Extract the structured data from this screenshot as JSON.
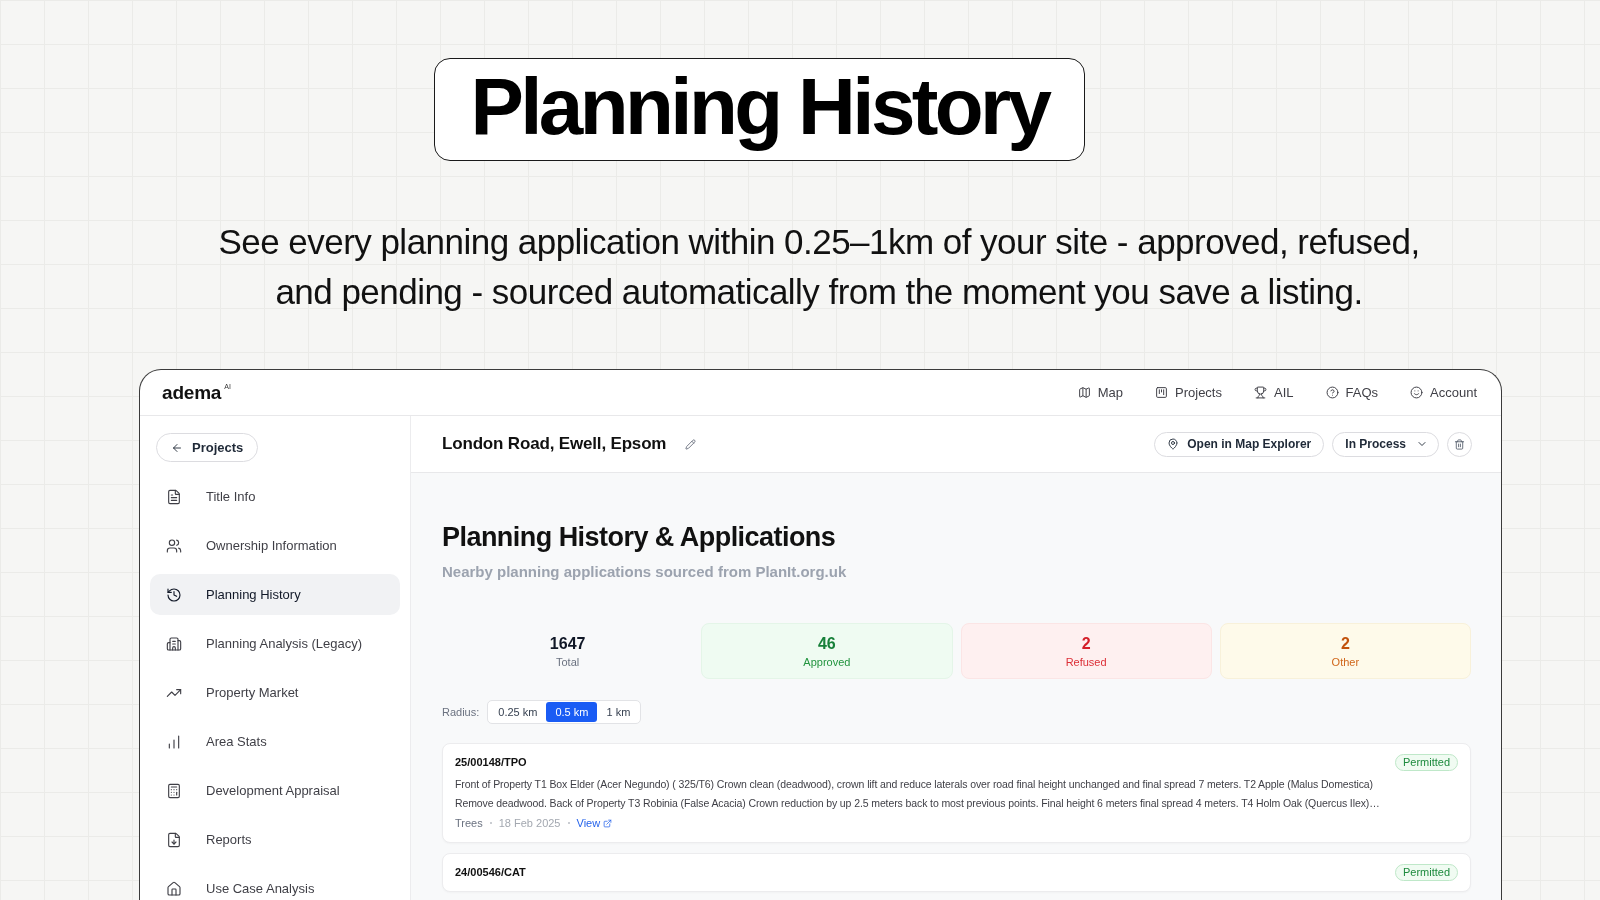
{
  "hero": {
    "title": "Planning History",
    "subtitle": "See every planning application within 0.25–1km of your site - approved, refused, and pending - sourced automatically from the moment you save a listing."
  },
  "app": {
    "logo": {
      "name": "adema",
      "badge": "AI"
    },
    "nav": [
      "Map",
      "Projects",
      "AIL",
      "FAQs",
      "Account"
    ],
    "back_button": "Projects",
    "sidebar": {
      "items": [
        {
          "label": "Title Info",
          "selected": false
        },
        {
          "label": "Ownership Information",
          "selected": false
        },
        {
          "label": "Planning History",
          "selected": true
        },
        {
          "label": "Planning Analysis (Legacy)",
          "selected": false
        },
        {
          "label": "Property Market",
          "selected": false
        },
        {
          "label": "Area Stats",
          "selected": false
        },
        {
          "label": "Development Appraisal",
          "selected": false
        },
        {
          "label": "Reports",
          "selected": false
        },
        {
          "label": "Use Case Analysis",
          "selected": false
        }
      ]
    },
    "header": {
      "title": "London Road, Ewell, Epsom",
      "map_button": "Open in Map Explorer",
      "status_select": "In Process"
    },
    "section": {
      "title": "Planning History & Applications",
      "subtitle": "Nearby planning applications sourced from PlanIt.org.uk"
    },
    "stats": [
      {
        "kind": "total",
        "value": "1647",
        "label": "Total"
      },
      {
        "kind": "approved",
        "value": "46",
        "label": "Approved"
      },
      {
        "kind": "refused",
        "value": "2",
        "label": "Refused"
      },
      {
        "kind": "other",
        "value": "2",
        "label": "Other"
      }
    ],
    "radius": {
      "label": "Radius:",
      "options": [
        {
          "label": "0.25 km",
          "selected": false
        },
        {
          "label": "0.5 km",
          "selected": true
        },
        {
          "label": "1 km",
          "selected": false
        }
      ]
    },
    "applications": [
      {
        "reference": "25/00148/TPO",
        "status": "Permitted",
        "description": "Front of Property T1 Box Elder (Acer Negundo) ( 325/T6) Crown clean (deadwood), crown lift and reduce laterals over road final height unchanged and final spread 7 meters. T2 Apple (Malus Domestica) Remove deadwood. Back of Property T3 Robinia (False Acacia) Crown reduction by up 2.5 meters back to most previous points. Final height 6 meters final spread 4 meters. T4 Holm Oak (Quercus Ilex)…",
        "category": "Trees",
        "date": "18 Feb 2025",
        "link": "View"
      },
      {
        "reference": "24/00546/CAT",
        "status": "Permitted"
      }
    ]
  }
}
